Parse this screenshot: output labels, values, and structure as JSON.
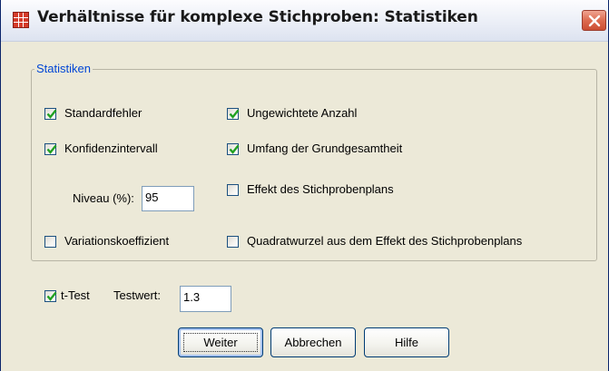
{
  "window": {
    "title": "Verhältnisse für komplexe Stichproben: Statistiken",
    "icon": "spss-table-icon",
    "close_icon": "close-icon"
  },
  "group": {
    "legend": "Statistiken"
  },
  "checkboxes": {
    "standardfehler": {
      "label": "Standardfehler",
      "checked": true
    },
    "konfidenzintervall": {
      "label": "Konfidenzintervall",
      "checked": true
    },
    "variationskoeffizient": {
      "label": "Variationskoeffizient",
      "checked": false
    },
    "ungewichtete_anzahl": {
      "label": "Ungewichtete Anzahl",
      "checked": true
    },
    "umfang_grundgesamtheit": {
      "label": "Umfang der Grundgesamtheit",
      "checked": true
    },
    "effekt_stichprobenplan": {
      "label": "Effekt des Stichprobenplans",
      "checked": false
    },
    "quadratwurzel_effekt": {
      "label": "Quadratwurzel aus dem Effekt des Stichprobenplans",
      "checked": false
    },
    "t_test": {
      "label": "t-Test",
      "checked": true
    }
  },
  "niveau": {
    "label": "Niveau (%):",
    "value": "95"
  },
  "testwert": {
    "label": "Testwert:",
    "value": "1.3"
  },
  "buttons": {
    "weiter": "Weiter",
    "abbrechen": "Abbrechen",
    "hilfe": "Hilfe"
  },
  "colors": {
    "dialog_bg": "#ece9d8",
    "legend": "#0046d5",
    "check": "#21a121",
    "close_red": "#cc4e33"
  }
}
